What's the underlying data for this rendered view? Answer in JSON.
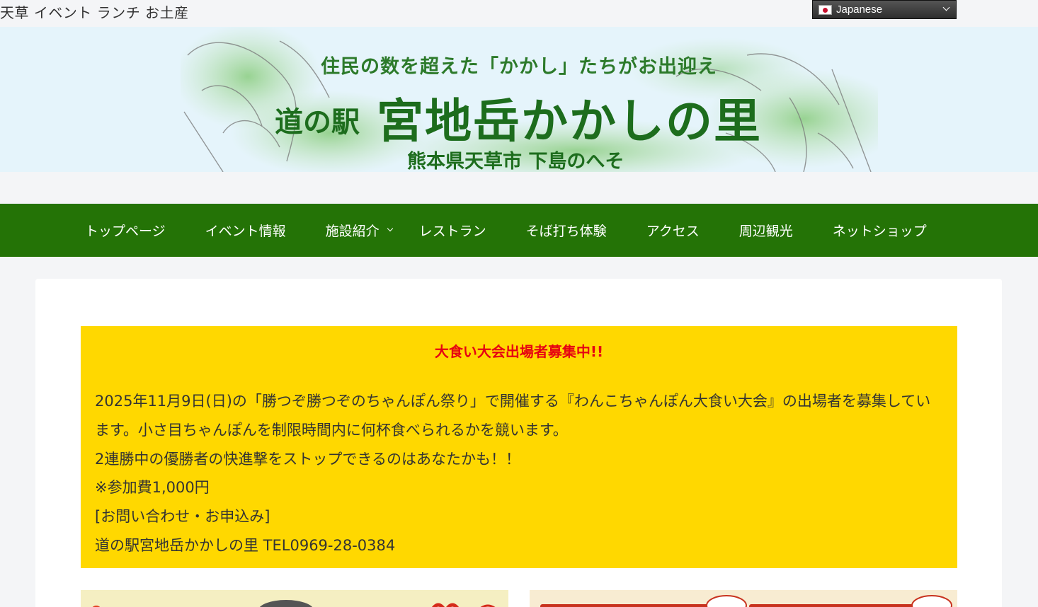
{
  "header": {
    "tagline": "天草 イベント ランチ お土産",
    "language": {
      "selected": "Japanese",
      "flag_icon": "japan-flag-icon"
    }
  },
  "banner": {
    "catchphrase": "住民の数を超えた「かかし」たちがお出迎え",
    "prefix": "道の駅",
    "name": "宮地岳かかしの里",
    "location": "熊本県天草市 下島のへそ"
  },
  "nav": {
    "items": [
      {
        "label": "トップページ"
      },
      {
        "label": "イベント情報"
      },
      {
        "label": "施設紹介",
        "has_submenu": true
      },
      {
        "label": "レストラン"
      },
      {
        "label": "そば打ち体験"
      },
      {
        "label": "アクセス"
      },
      {
        "label": "周辺観光"
      },
      {
        "label": "ネットショップ"
      }
    ],
    "background": "#247306"
  },
  "notice": {
    "title": "大食い大会出場者募集中!!",
    "lines": [
      "2025年11月9日(日)の「勝つぞ勝つぞのちゃんぽん祭り」で開催する『わんこちゃんぽん大食い大会』の出場者を募集しています。小さ目ちゃんぽんを制限時間内に何杯食べられるかを競います。",
      "2連勝中の優勝者の快進撃をストップできるのはあなたかも！！",
      "※参加費1,000円",
      "[お問い合わせ・お申込み]",
      "道の駅宮地岳かかしの里 TEL0969-28-0384"
    ],
    "background": "#ffd800",
    "title_color": "#e60012"
  }
}
